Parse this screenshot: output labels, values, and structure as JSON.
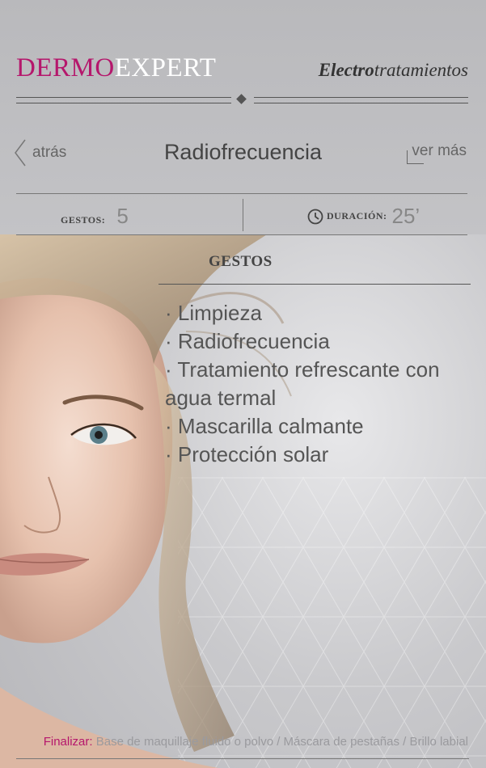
{
  "header": {
    "brand_part1": "DERMO",
    "brand_part2": "EXPERT",
    "section_bold": "Electro",
    "section_rest": "tratamientos"
  },
  "nav": {
    "back_label": "atrás",
    "title": "Radiofrecuencia",
    "more_label": "ver más"
  },
  "stats": {
    "gestos_label": "GESTOS:",
    "gestos_value": "5",
    "duration_label": "DURACIÓN:",
    "duration_value": "25’"
  },
  "gestos": {
    "heading": "GESTOS",
    "items": [
      "· Limpieza",
      "· Radiofrecuencia",
      "· Tratamiento refrescante con agua termal",
      "· Mascarilla calmante",
      "· Protección solar"
    ]
  },
  "footer": {
    "label": "Finalizar:",
    "text": "Base de maquillaje fluido o polvo / Máscara de pestañas / Brillo labial"
  },
  "colors": {
    "brand": "#b5176c",
    "text": "#555555"
  },
  "icons": {
    "back": "chevron-left-icon",
    "clock": "clock-icon"
  }
}
